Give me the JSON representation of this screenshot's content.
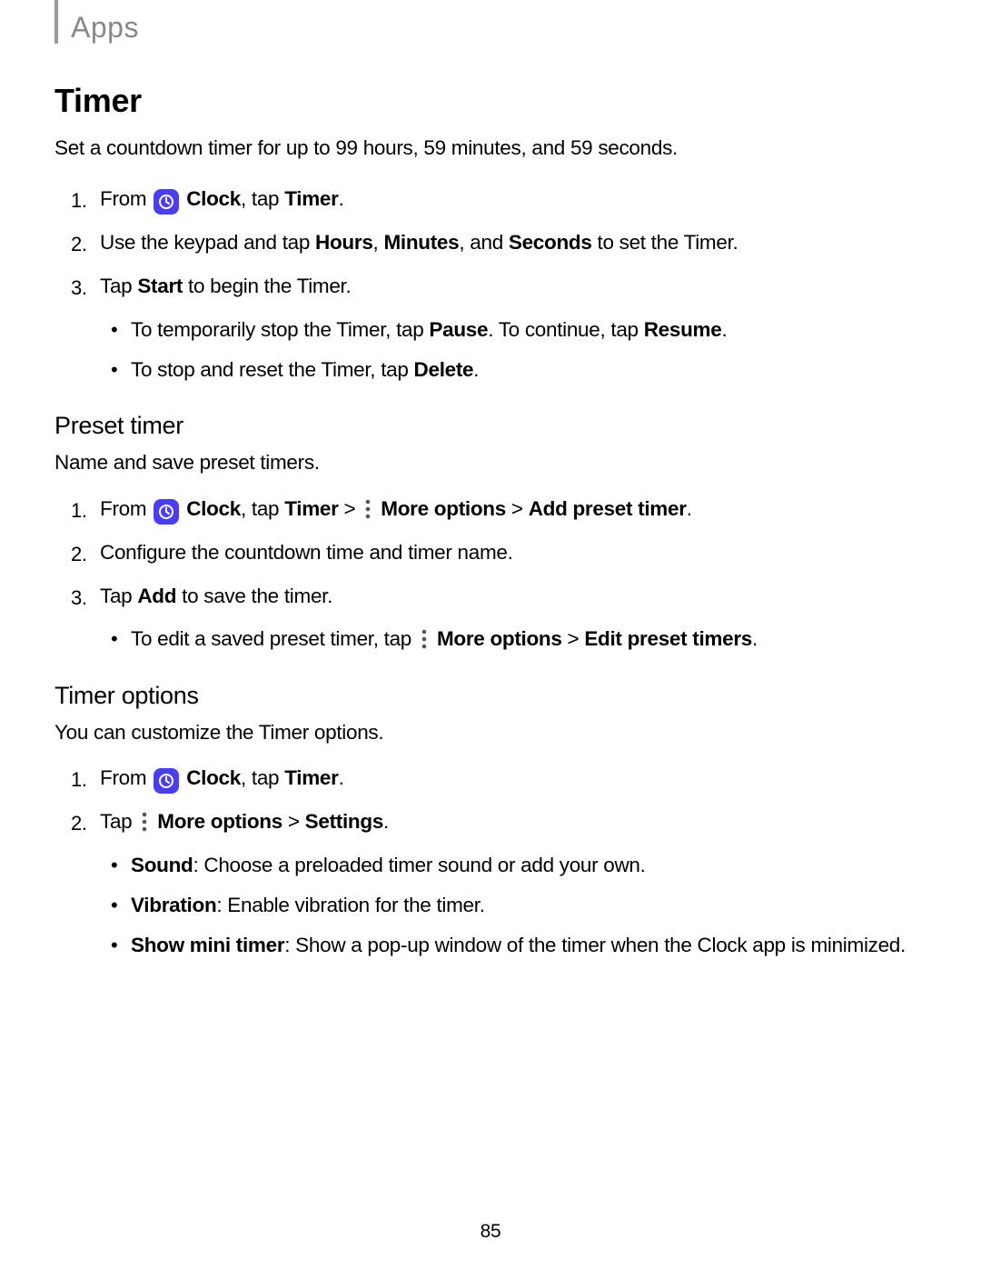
{
  "header": {
    "label": "Apps"
  },
  "section": {
    "title": "Timer",
    "intro": "Set a countdown timer for up to 99 hours, 59 minutes, and 59 seconds."
  },
  "s1": {
    "n1": "1.",
    "l1_pre": "From ",
    "l1_clock": "Clock",
    "l1_mid": ", tap ",
    "l1_timer": "Timer",
    "l1_end": ".",
    "n2": "2.",
    "l2_a": "Use the keypad and tap ",
    "l2_hours": "Hours",
    "l2_b": ", ",
    "l2_minutes": "Minutes",
    "l2_c": ", and ",
    "l2_seconds": "Seconds",
    "l2_d": " to set the Timer.",
    "n3": "3.",
    "l3_a": "Tap ",
    "l3_start": "Start",
    "l3_b": " to begin the Timer.",
    "b1_a": "To temporarily stop the Timer, tap ",
    "b1_pause": "Pause",
    "b1_b": ". To continue, tap ",
    "b1_resume": "Resume",
    "b1_c": ".",
    "b2_a": "To stop and reset the Timer, tap ",
    "b2_delete": "Delete",
    "b2_b": "."
  },
  "preset": {
    "heading": "Preset timer",
    "intro": "Name and save preset timers.",
    "n1": "1.",
    "l1_pre": "From ",
    "l1_clock": "Clock",
    "l1_a": ", tap ",
    "l1_timer": "Timer",
    "l1_gt1": " > ",
    "l1_more": "More options",
    "l1_gt2": " > ",
    "l1_add": "Add preset timer",
    "l1_end": ".",
    "n2": "2.",
    "l2": "Configure the countdown time and timer name.",
    "n3": "3.",
    "l3_a": "Tap ",
    "l3_add": "Add",
    "l3_b": " to save the timer.",
    "b1_a": "To edit a saved preset timer, tap ",
    "b1_more": "More options",
    "b1_gt": " > ",
    "b1_edit": "Edit preset timers",
    "b1_end": "."
  },
  "options": {
    "heading": "Timer options",
    "intro": "You can customize the Timer options.",
    "n1": "1.",
    "l1_pre": "From ",
    "l1_clock": "Clock",
    "l1_a": ", tap ",
    "l1_timer": "Timer",
    "l1_end": ".",
    "n2": "2.",
    "l2_a": "Tap ",
    "l2_more": "More options",
    "l2_gt": " > ",
    "l2_settings": "Settings",
    "l2_end": ".",
    "b1_label": "Sound",
    "b1_text": ": Choose a preloaded timer sound or add your own.",
    "b2_label": "Vibration",
    "b2_text": ": Enable vibration for the timer.",
    "b3_label": "Show mini timer",
    "b3_text": ": Show a pop-up window of the timer when the Clock app is minimized."
  },
  "page_number": "85"
}
